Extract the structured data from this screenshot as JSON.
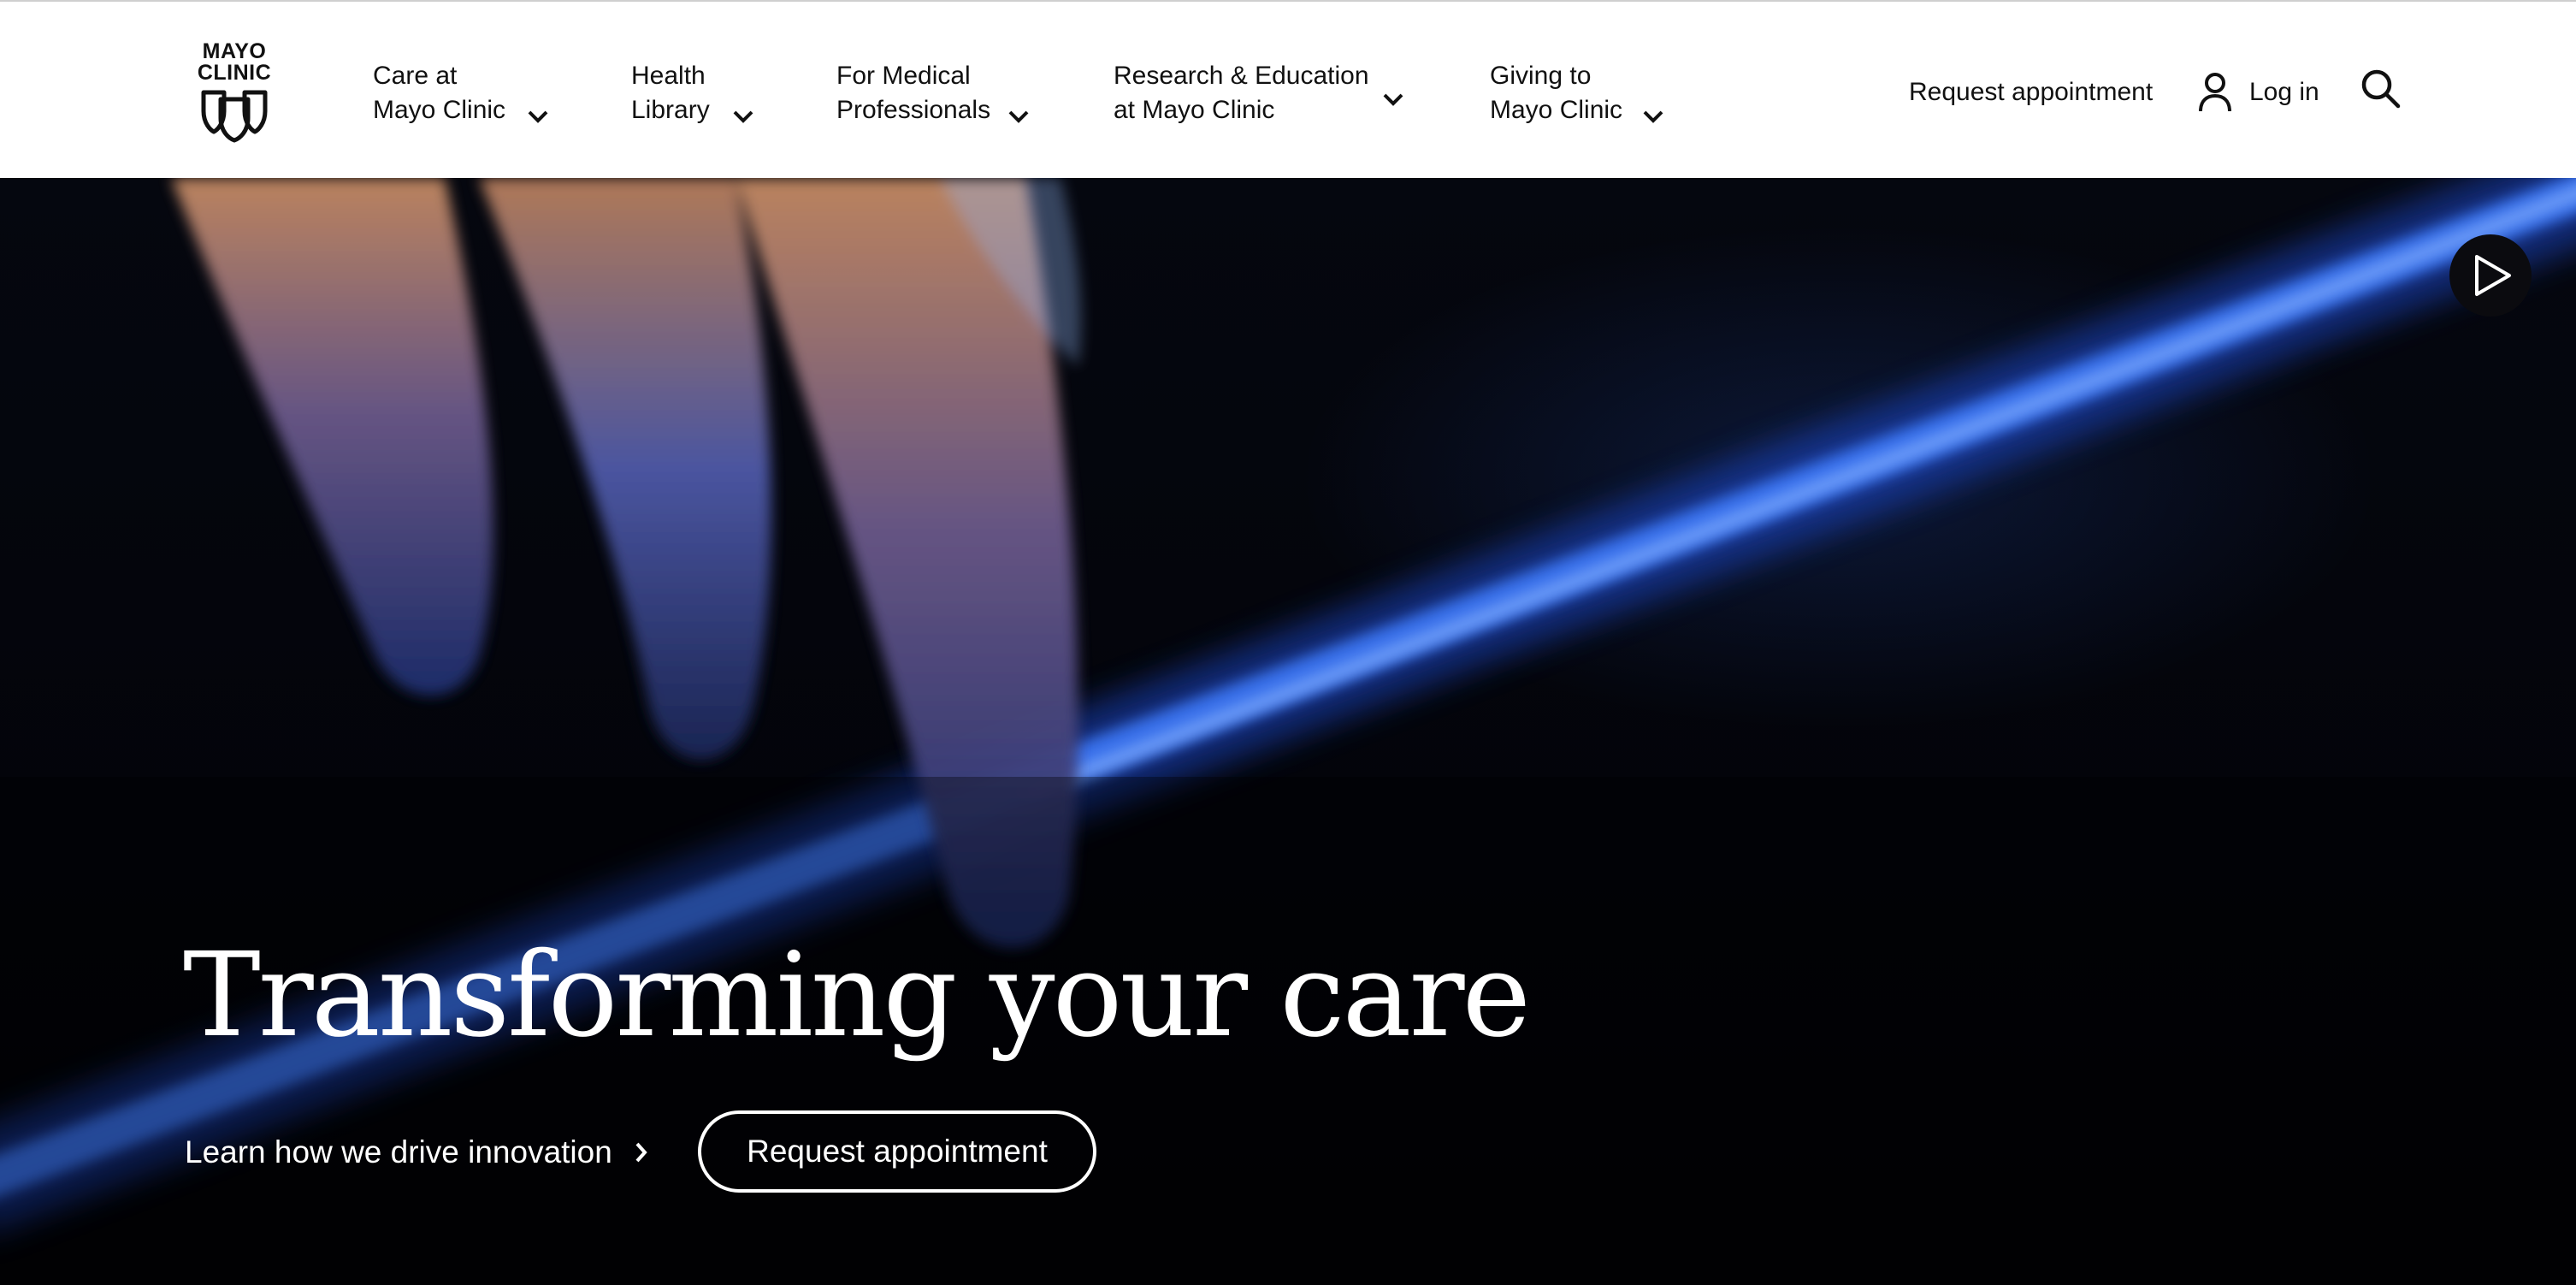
{
  "header": {
    "logo": {
      "line1": "MAYO",
      "line2": "CLINIC",
      "icon": "mayo-shields-logo"
    },
    "nav": [
      {
        "label": "Care at\nMayo Clinic",
        "icon": "chevron-down-icon"
      },
      {
        "label": "Health\nLibrary",
        "icon": "chevron-down-icon"
      },
      {
        "label": "For Medical\nProfessionals",
        "icon": "chevron-down-icon"
      },
      {
        "label": "Research & Education\nat Mayo Clinic",
        "icon": "chevron-down-icon"
      },
      {
        "label": "Giving to\nMayo Clinic",
        "icon": "chevron-down-icon"
      }
    ],
    "request_appointment": "Request appointment",
    "login": {
      "label": "Log in",
      "icon": "user-icon"
    },
    "search_icon": "search-icon"
  },
  "hero": {
    "title": "Transforming your care",
    "innovation_link": "Learn how we drive innovation",
    "innovation_icon": "chevron-right-icon",
    "request_button": "Request appointment",
    "play_icon": "play-icon"
  },
  "colors": {
    "header_bg": "#ffffff",
    "text_dark": "#111111",
    "hero_bg": "#03040a",
    "accent_blue": "#2f6cff",
    "text_light": "#ffffff"
  }
}
